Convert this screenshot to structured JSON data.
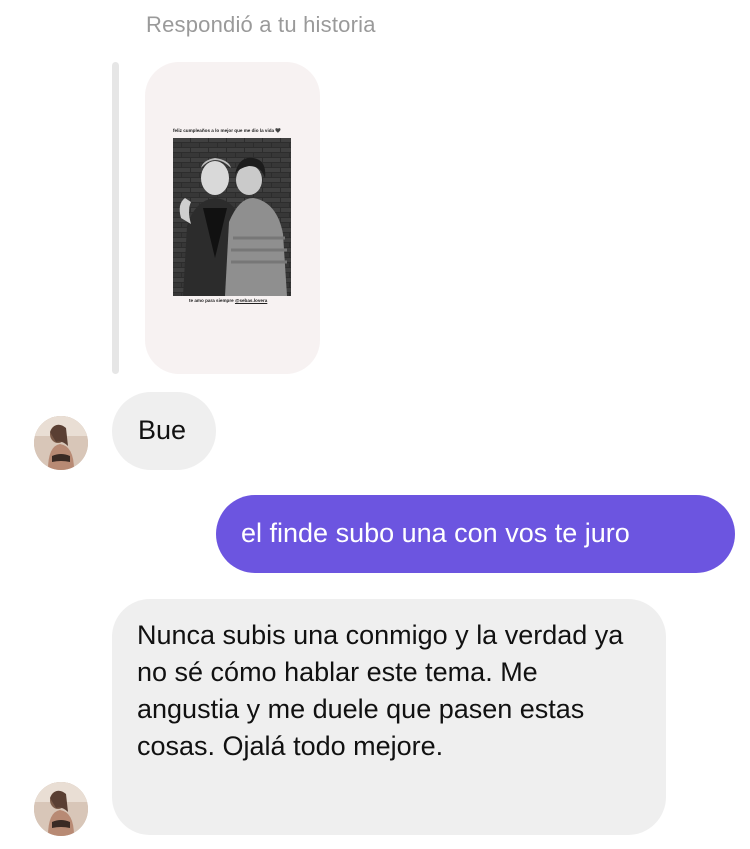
{
  "reply": {
    "header": "Respondió a tu historia",
    "story": {
      "caption_top": "feliz cumpleaños a lo mejor que me dio la vida 🖤",
      "caption_bottom_text": "te amo para siempre ",
      "caption_bottom_tag": "@sebas.lovera"
    }
  },
  "messages": [
    {
      "from": "them",
      "text": "Bue"
    },
    {
      "from": "me",
      "text": "el finde subo una con vos te juro"
    },
    {
      "from": "them",
      "text": "Nunca subis una conmigo y la verdad ya no sé cómo hablar este tema. Me angustia y me duele que pasen estas cosas. Ojalá todo mejore."
    }
  ],
  "colors": {
    "outgoing_bubble": "#6c55e0",
    "incoming_bubble": "#efefef"
  }
}
